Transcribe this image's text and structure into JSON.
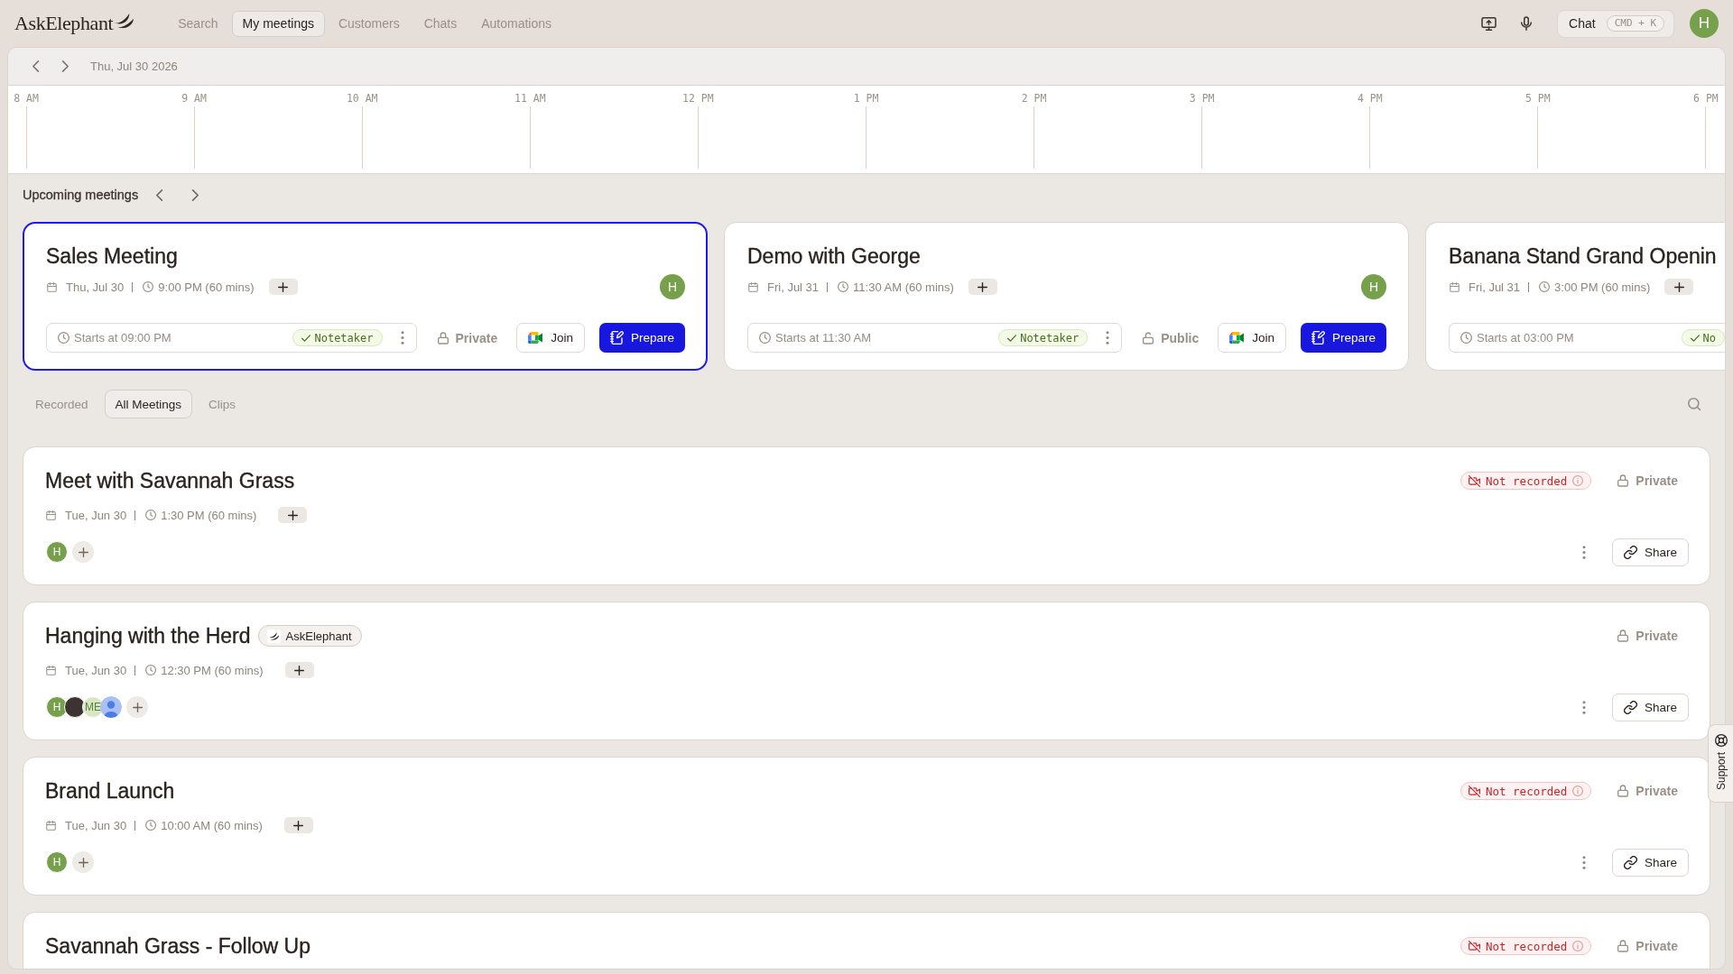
{
  "top_bar": {
    "logo": "AskElephant",
    "nav": [
      {
        "label": "Search",
        "selected": false
      },
      {
        "label": "My meetings",
        "selected": true
      },
      {
        "label": "Customers",
        "selected": false
      },
      {
        "label": "Chats",
        "selected": false
      },
      {
        "label": "Automations",
        "selected": false
      }
    ],
    "chat_button": {
      "label": "Chat",
      "shortcut": "CMD + K"
    },
    "avatar": "H"
  },
  "date_bar": {
    "date": "Thu, Jul 30 2026"
  },
  "timeline": {
    "hours": [
      "8 AM",
      "9 AM",
      "10 AM",
      "11 AM",
      "12 PM",
      "1 PM",
      "2 PM",
      "3 PM",
      "4 PM",
      "5 PM",
      "6 PM"
    ]
  },
  "upcoming": {
    "title": "Upcoming meetings",
    "cards": [
      {
        "title": "Sales Meeting",
        "selected": true,
        "date": "Thu, Jul 30",
        "time": "9:00 PM (60 mins)",
        "avatar": "H",
        "starts": "Starts at 09:00 PM",
        "notetaker": "Notetaker",
        "privacy": {
          "label": "Private",
          "locked": true
        },
        "join": "Join",
        "prepare": "Prepare"
      },
      {
        "title": "Demo with George",
        "selected": false,
        "date": "Fri, Jul 31",
        "time": "11:30 AM (60 mins)",
        "avatar": "H",
        "starts": "Starts at 11:30 AM",
        "notetaker": "Notetaker",
        "privacy": {
          "label": "Public",
          "locked": false
        },
        "join": "Join",
        "prepare": "Prepare"
      },
      {
        "title": "Banana Stand Grand Openin",
        "selected": false,
        "date": "Fri, Jul 31",
        "time": "3:00 PM (60 mins)",
        "starts": "Starts at 03:00 PM",
        "notetaker": "No"
      }
    ]
  },
  "tabs": [
    {
      "label": "Recorded",
      "selected": false
    },
    {
      "label": "All Meetings",
      "selected": true
    },
    {
      "label": "Clips",
      "selected": false
    }
  ],
  "meetings": [
    {
      "title": "Meet with Savannah Grass",
      "status": "Not recorded",
      "privacy": {
        "label": "Private",
        "locked": true
      },
      "date": "Tue, Jun 30",
      "time": "1:30 PM (60 mins)",
      "attendees": [
        {
          "kind": "initials",
          "text": "H",
          "color": "#76a04b"
        }
      ],
      "share": "Share"
    },
    {
      "title": "Hanging with the Herd",
      "tag": "AskElephant",
      "privacy": {
        "label": "Private",
        "locked": true
      },
      "date": "Tue, Jun 30",
      "time": "12:30 PM (60 mins)",
      "attendees": [
        {
          "kind": "initials",
          "text": "H",
          "color": "#76a04b"
        },
        {
          "kind": "photo"
        },
        {
          "kind": "initials",
          "text": "ME",
          "color": "#d6e7c4"
        },
        {
          "kind": "silhouette"
        }
      ],
      "share": "Share"
    },
    {
      "title": "Brand Launch",
      "status": "Not recorded",
      "privacy": {
        "label": "Private",
        "locked": true
      },
      "date": "Tue, Jun 30",
      "time": "10:00 AM (60 mins)",
      "attendees": [
        {
          "kind": "initials",
          "text": "H",
          "color": "#76a04b"
        }
      ],
      "share": "Share"
    },
    {
      "title": "Savannah Grass - Follow Up",
      "status": "Not recorded",
      "privacy": {
        "label": "Private",
        "locked": true
      }
    }
  ],
  "support": "Support"
}
